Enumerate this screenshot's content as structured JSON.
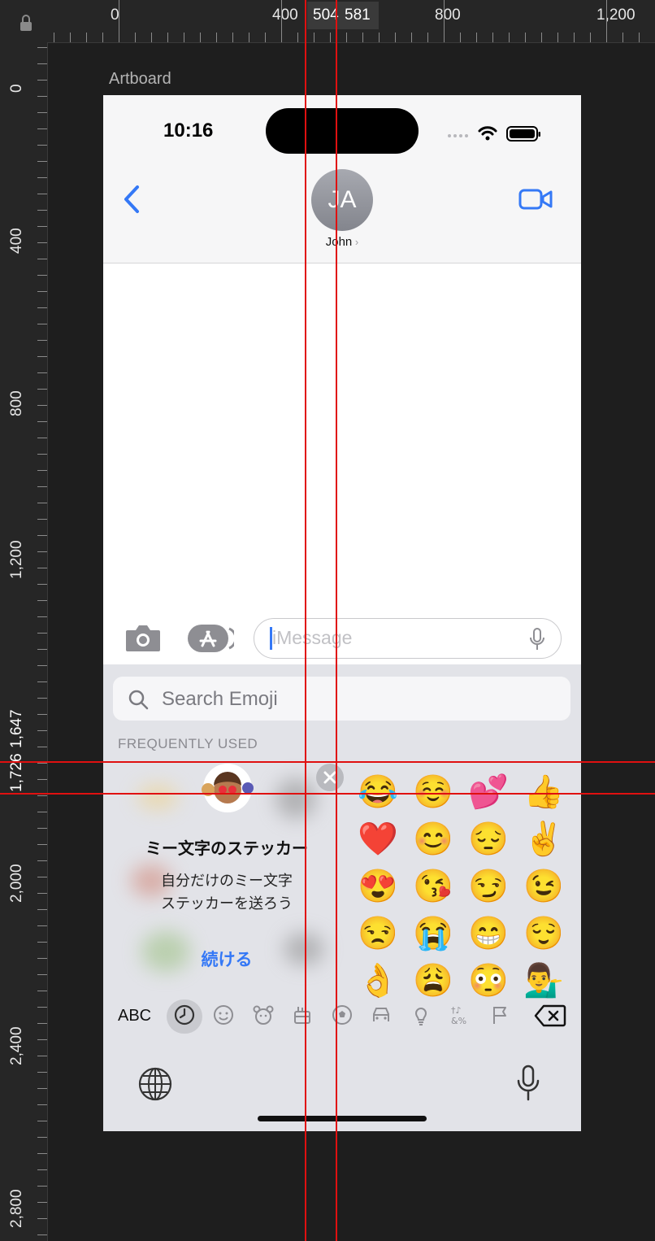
{
  "rulers": {
    "horizontal_labels": [
      "0",
      "400",
      "504",
      "581",
      "800",
      "1,200"
    ],
    "vertical_labels": [
      "0",
      "400",
      "800",
      "1,200",
      "1,726",
      "1,647",
      "2,000",
      "2,400",
      "2,800"
    ],
    "lock_icon": "lock-icon"
  },
  "artboard": {
    "label": "Artboard"
  },
  "status_bar": {
    "time": "10:16"
  },
  "conversation_header": {
    "avatar_initials": "JA",
    "contact_name": "John",
    "back_icon": "chevron-left-icon",
    "video_icon": "video-camera-icon"
  },
  "message_bar": {
    "placeholder": "iMessage",
    "camera_icon": "camera-icon",
    "apps_icon": "app-store-icon",
    "mic_icon": "microphone-icon"
  },
  "emoji_keyboard": {
    "search_placeholder": "Search Emoji",
    "section_title": "FREQUENTLY USED",
    "promo": {
      "title": "ミー文字のステッカー",
      "body_line1": "自分だけのミー文字",
      "body_line2": "ステッカーを送ろう",
      "cta": "続ける"
    },
    "emojis": [
      [
        "😂",
        "☺️",
        "💕",
        "👍"
      ],
      [
        "❤️",
        "😊",
        "😔",
        "✌️"
      ],
      [
        "😍",
        "😘",
        "😏",
        "😉"
      ],
      [
        "😒",
        "😭",
        "😁",
        "😌"
      ],
      [
        "👌",
        "😩",
        "😳",
        "💁‍♂️"
      ]
    ],
    "abc_label": "ABC",
    "categories": [
      "recent-clock-icon",
      "smiley-icon",
      "animal-icon",
      "food-icon",
      "soccer-ball-icon",
      "car-icon",
      "lightbulb-icon",
      "symbols-icon",
      "flag-icon"
    ],
    "delete_icon": "delete-backward-icon",
    "globe_icon": "globe-icon",
    "dictation_icon": "microphone-icon"
  },
  "colors": {
    "accent": "#3478f6",
    "guide": "#e01010"
  }
}
